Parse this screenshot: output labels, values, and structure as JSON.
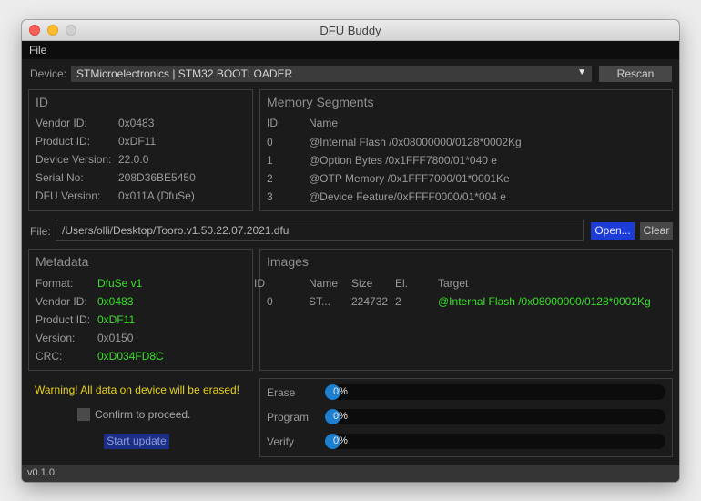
{
  "window": {
    "title": "DFU Buddy"
  },
  "menu": {
    "file": "File"
  },
  "device": {
    "label": "Device:",
    "selected": "STMicroelectronics | STM32  BOOTLOADER",
    "rescan": "Rescan"
  },
  "id_panel": {
    "title": "ID",
    "rows": [
      {
        "label": "Vendor ID:",
        "value": "0x0483"
      },
      {
        "label": "Product ID:",
        "value": "0xDF11"
      },
      {
        "label": "Device Version:",
        "value": "22.0.0"
      },
      {
        "label": "Serial No:",
        "value": "208D36BE5450"
      },
      {
        "label": "DFU Version:",
        "value": "0x011A (DfuSe)"
      }
    ]
  },
  "memory": {
    "title": "Memory Segments",
    "headers": {
      "id": "ID",
      "name": "Name"
    },
    "rows": [
      {
        "id": "0",
        "name": "@Internal Flash  /0x08000000/0128*0002Kg"
      },
      {
        "id": "1",
        "name": "@Option Bytes  /0x1FFF7800/01*040 e"
      },
      {
        "id": "2",
        "name": "@OTP Memory /0x1FFF7000/01*0001Ke"
      },
      {
        "id": "3",
        "name": "@Device Feature/0xFFFF0000/01*004 e"
      }
    ]
  },
  "file": {
    "label": "File:",
    "path": "/Users/olli/Desktop/Tooro.v1.50.22.07.2021.dfu",
    "open": "Open...",
    "clear": "Clear"
  },
  "metadata": {
    "title": "Metadata",
    "rows": [
      {
        "label": "Format:",
        "value": "DfuSe v1",
        "color": "#3adf2a"
      },
      {
        "label": "Vendor ID:",
        "value": "0x0483",
        "color": "#3adf2a"
      },
      {
        "label": "Product ID:",
        "value": "0xDF11",
        "color": "#3adf2a"
      },
      {
        "label": "Version:",
        "value": "0x0150",
        "color": "#9a9a9a"
      },
      {
        "label": "CRC:",
        "value": "0xD034FD8C",
        "color": "#3adf2a"
      }
    ]
  },
  "images": {
    "title": "Images",
    "headers": {
      "id": "ID",
      "name": "Name",
      "size": "Size",
      "el": "El.",
      "target": "Target"
    },
    "rows": [
      {
        "id": "0",
        "name": "ST...",
        "size": "224732",
        "el": "2",
        "target": "@Internal Flash  /0x08000000/0128*0002Kg"
      }
    ]
  },
  "update": {
    "warning": "Warning! All data on device will be erased!",
    "confirm": "Confirm to proceed.",
    "confirm_checked": false,
    "start": "Start update"
  },
  "progress": [
    {
      "label": "Erase",
      "text": "0%",
      "value": 0
    },
    {
      "label": "Program",
      "text": "0%",
      "value": 0
    },
    {
      "label": "Verify",
      "text": "0%",
      "value": 0
    }
  ],
  "status": {
    "version": "v0.1.0"
  },
  "colors": {
    "accent_green": "#3adf2a",
    "warning_yellow": "#e6d21e",
    "button_blue": "#1d3bd6",
    "progress_blue": "#1c7fd0"
  }
}
